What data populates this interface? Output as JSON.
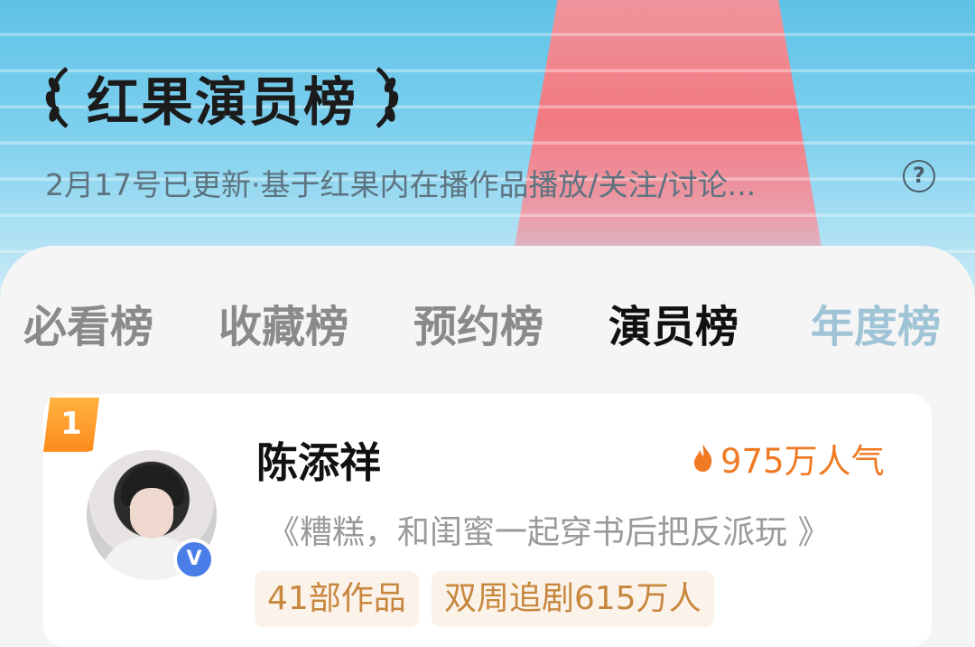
{
  "header": {
    "title": "红果演员榜",
    "subtitle": "2月17号已更新·基于红果内在播作品播放/关注/讨论...",
    "help_symbol": "?"
  },
  "tabs": [
    {
      "label": "必看榜",
      "active": false
    },
    {
      "label": "收藏榜",
      "active": false
    },
    {
      "label": "预约榜",
      "active": false
    },
    {
      "label": "演员榜",
      "active": true
    },
    {
      "label": "年度榜",
      "active": false
    }
  ],
  "ranking": [
    {
      "rank": "1",
      "name": "陈添祥",
      "popularity": "975万人气",
      "works": "《糟糕，和闺蜜一起穿书后把反派玩   》",
      "tags": [
        "41部作品",
        "双周追剧615万人"
      ],
      "verified_symbol": "V"
    }
  ],
  "colors": {
    "accent_orange": "#f07a24",
    "badge_orange": "#ff8a1e",
    "verified_blue": "#4a7de8",
    "tag_bg": "#fbf3ea",
    "tag_text": "#c8873e"
  },
  "icons": [
    "laurel-left-icon",
    "laurel-right-icon",
    "help-icon",
    "flame-icon",
    "verified-icon"
  ]
}
